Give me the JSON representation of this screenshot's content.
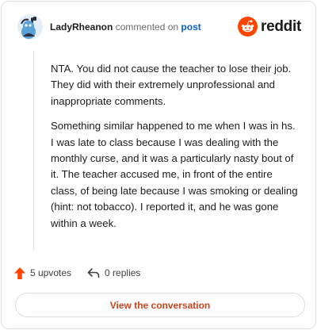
{
  "header": {
    "username": "LadyRheanon",
    "action_text": "commented on",
    "target_text": "post",
    "brand_name": "reddit",
    "brand_color": "#ff4500"
  },
  "comment": {
    "paragraphs": [
      "NTA. You did not cause the teacher to lose their job. They did with their extremely unprofessional and inappropriate comments.",
      "Something similar happened to me when I was in hs. I was late to class because I was dealing with the monthly curse, and it was a particularly nasty bout of it. The teacher accused me, in front of the entire class, of being late because I was smoking or dealing (hint: not tobacco). I reported it, and he was gone within a week."
    ]
  },
  "footer": {
    "upvotes_label": "5 upvotes",
    "replies_label": "0 replies",
    "upvote_color": "#ff4500"
  },
  "cta": {
    "label": "View the conversation",
    "color": "#c9441c"
  },
  "icons": [
    "avatar-icon",
    "reddit-logo-icon",
    "upvote-arrow-icon",
    "reply-arrow-icon"
  ]
}
